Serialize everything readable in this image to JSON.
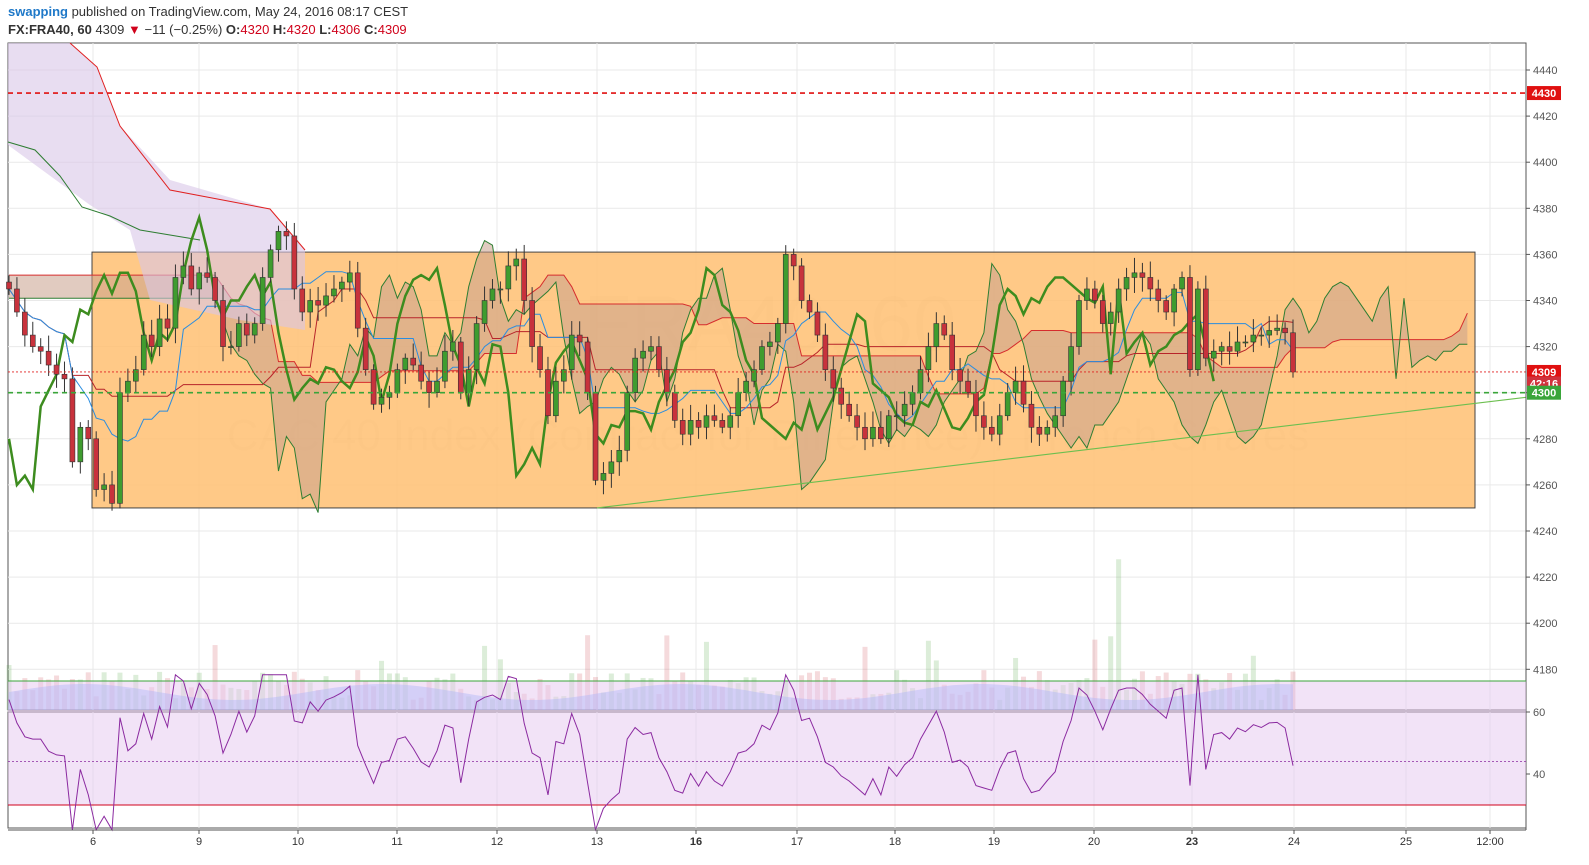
{
  "header": {
    "author": "swapping",
    "published_text": "published on TradingView.com, May 24, 2016 08:17 CEST",
    "symbol": "FX:FRA40, 60",
    "last": "4309",
    "change": "−11 (−0.25%)",
    "open_label": "O:",
    "open": "4320",
    "high_label": "H:",
    "high": "4320",
    "low_label": "L:",
    "low": "4306",
    "close_label": "C:",
    "close": "4309"
  },
  "watermark": {
    "symbol": "FRA40, 60",
    "description": "CAC 40 Index (Contract for Difference) / French Shares"
  },
  "colors": {
    "up": "#3f9c2f",
    "down": "#c8323c",
    "box": "#ffbf72",
    "cloud_bear": "#d9c6e8",
    "cloud_bull": "#c8a08c",
    "chikou": "#3d8c1f",
    "tenkan": "#2a8de0",
    "kijun": "#b7242a",
    "rsi": "#8b2aa0",
    "resistance": "#e01010",
    "support": "#3aa53a"
  },
  "chart_data": [
    {
      "type": "candlestick",
      "ylim": [
        4160,
        4450
      ],
      "y_ticks": [
        4180,
        4200,
        4220,
        4240,
        4260,
        4280,
        4300,
        4320,
        4340,
        4360,
        4380,
        4400,
        4420,
        4440
      ],
      "x_ticks": [
        "6",
        "9",
        "10",
        "11",
        "12",
        "13",
        "16",
        "17",
        "18",
        "19",
        "20",
        "23",
        "24",
        "25",
        "12:00"
      ],
      "bold_ticks": [
        "16",
        "23"
      ],
      "price_labels": [
        {
          "label": "4430",
          "value": 4430,
          "color": "#e01010"
        },
        {
          "label": "4309",
          "value": 4309,
          "color": "#e01010"
        },
        {
          "label": "42:16",
          "value": 4304,
          "color": "#d0323c"
        },
        {
          "label": "4300",
          "value": 4300,
          "color": "#3aa53a"
        }
      ],
      "horizontal_lines": [
        {
          "value": 4430,
          "style": "dashed",
          "color": "#e01010"
        },
        {
          "value": 4300,
          "style": "dashed",
          "color": "#3aa53a"
        }
      ],
      "range_box": {
        "top": 4361,
        "bottom": 4250
      },
      "trend_line": {
        "from": {
          "x": "13",
          "y": 4250
        },
        "to": {
          "x": "24",
          "y": 4300
        }
      },
      "closes": [
        4345,
        4335,
        4325,
        4320,
        4318,
        4312,
        4308,
        4306,
        4270,
        4285,
        4280,
        4258,
        4260,
        4252,
        4300,
        4305,
        4310,
        4325,
        4320,
        4332,
        4328,
        4350,
        4355,
        4345,
        4352,
        4350,
        4340,
        4320,
        4320,
        4330,
        4325,
        4330,
        4350,
        4362,
        4370,
        4368,
        4345,
        4335,
        4340,
        4338,
        4342,
        4345,
        4348,
        4352,
        4328,
        4310,
        4295,
        4298,
        4300,
        4310,
        4315,
        4312,
        4305,
        4300,
        4305,
        4318,
        4322,
        4300,
        4310,
        4330,
        4340,
        4345,
        4345,
        4355,
        4358,
        4340,
        4320,
        4310,
        4290,
        4305,
        4310,
        4325,
        4322,
        4300,
        4262,
        4265,
        4270,
        4275,
        4300,
        4315,
        4318,
        4320,
        4310,
        4300,
        4288,
        4282,
        4288,
        4285,
        4290,
        4288,
        4285,
        4290,
        4300,
        4305,
        4310,
        4320,
        4322,
        4330,
        4360,
        4355,
        4340,
        4335,
        4325,
        4310,
        4302,
        4295,
        4290,
        4285,
        4280,
        4285,
        4280,
        4290,
        4290,
        4295,
        4300,
        4310,
        4320,
        4330,
        4325,
        4310,
        4305,
        4300,
        4290,
        4285,
        4282,
        4290,
        4300,
        4305,
        4295,
        4285,
        4282,
        4285,
        4290,
        4305,
        4320,
        4340,
        4345,
        4340,
        4330,
        4335,
        4345,
        4350,
        4352,
        4350,
        4345,
        4340,
        4335,
        4345,
        4350,
        4310,
        4345,
        4315,
        4318,
        4320,
        4318,
        4322,
        4322,
        4325,
        4325,
        4327,
        4328,
        4326,
        4309
      ],
      "rsi": {
        "ylim": [
          20,
          72
        ],
        "ticks": [
          20,
          40,
          60
        ],
        "overbought": 70,
        "oversold": 30,
        "midline": 44
      }
    }
  ]
}
